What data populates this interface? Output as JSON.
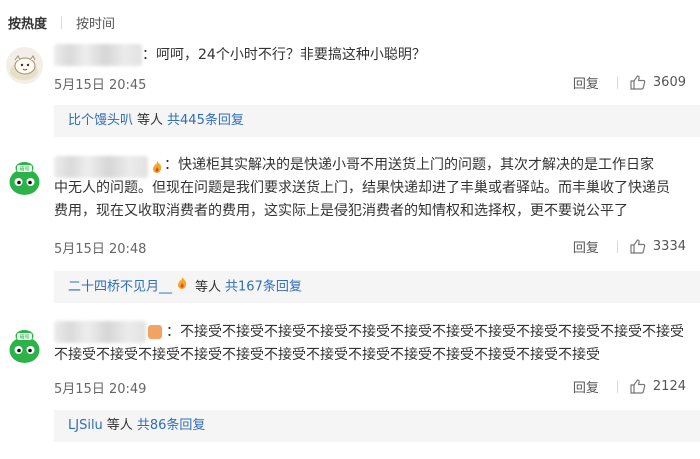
{
  "sort": {
    "hot_label": "按热度",
    "time_label": "按时间"
  },
  "comments": [
    {
      "text": "：呵呵，24个小时不行？非要搞这种小聪明？",
      "date": "5月15日 20:45",
      "reply_label": "回复",
      "likes": "3609",
      "replies": {
        "user": "比个馒头叭",
        "mid": "等人",
        "count": "共445条回复"
      }
    },
    {
      "text_line1": "：快递柜其实解决的是快递小哥不用送货上门的问题，其次才解决的是工作日家",
      "text_rest": "中无人的问题。但现在问题是我们要求送货上门，结果快递却进了丰巢或者驿站。而丰巢收了快递员费用，现在又收取消费者的费用，这实际上是侵犯消费者的知情权和选择权，更不要说公平了",
      "date": "5月15日 20:48",
      "reply_label": "回复",
      "likes": "3334",
      "replies": {
        "user": "二十四桥不见月__",
        "mid": "等人",
        "count": "共167条回复"
      }
    },
    {
      "text_line1": "：不接受不接受不接受不接受不接受不接受不接受不接受不接受不接受不接受不接受",
      "text_rest": "不接受不接受不接受不接受不接受不接受不接受不接受不接受不接受不接受不接受不接受",
      "date": "5月15日 20:49",
      "reply_label": "回复",
      "likes": "2124",
      "replies": {
        "user": "LJSilu",
        "mid": "等人",
        "count": "共86条回复"
      }
    }
  ],
  "colors": {
    "link": "#2f6dbb",
    "reply_bg": "#f5f5f5",
    "badge": "#f5a623"
  },
  "icons": {
    "like": "thumbs-up-icon",
    "badge": "fire-badge-icon"
  }
}
